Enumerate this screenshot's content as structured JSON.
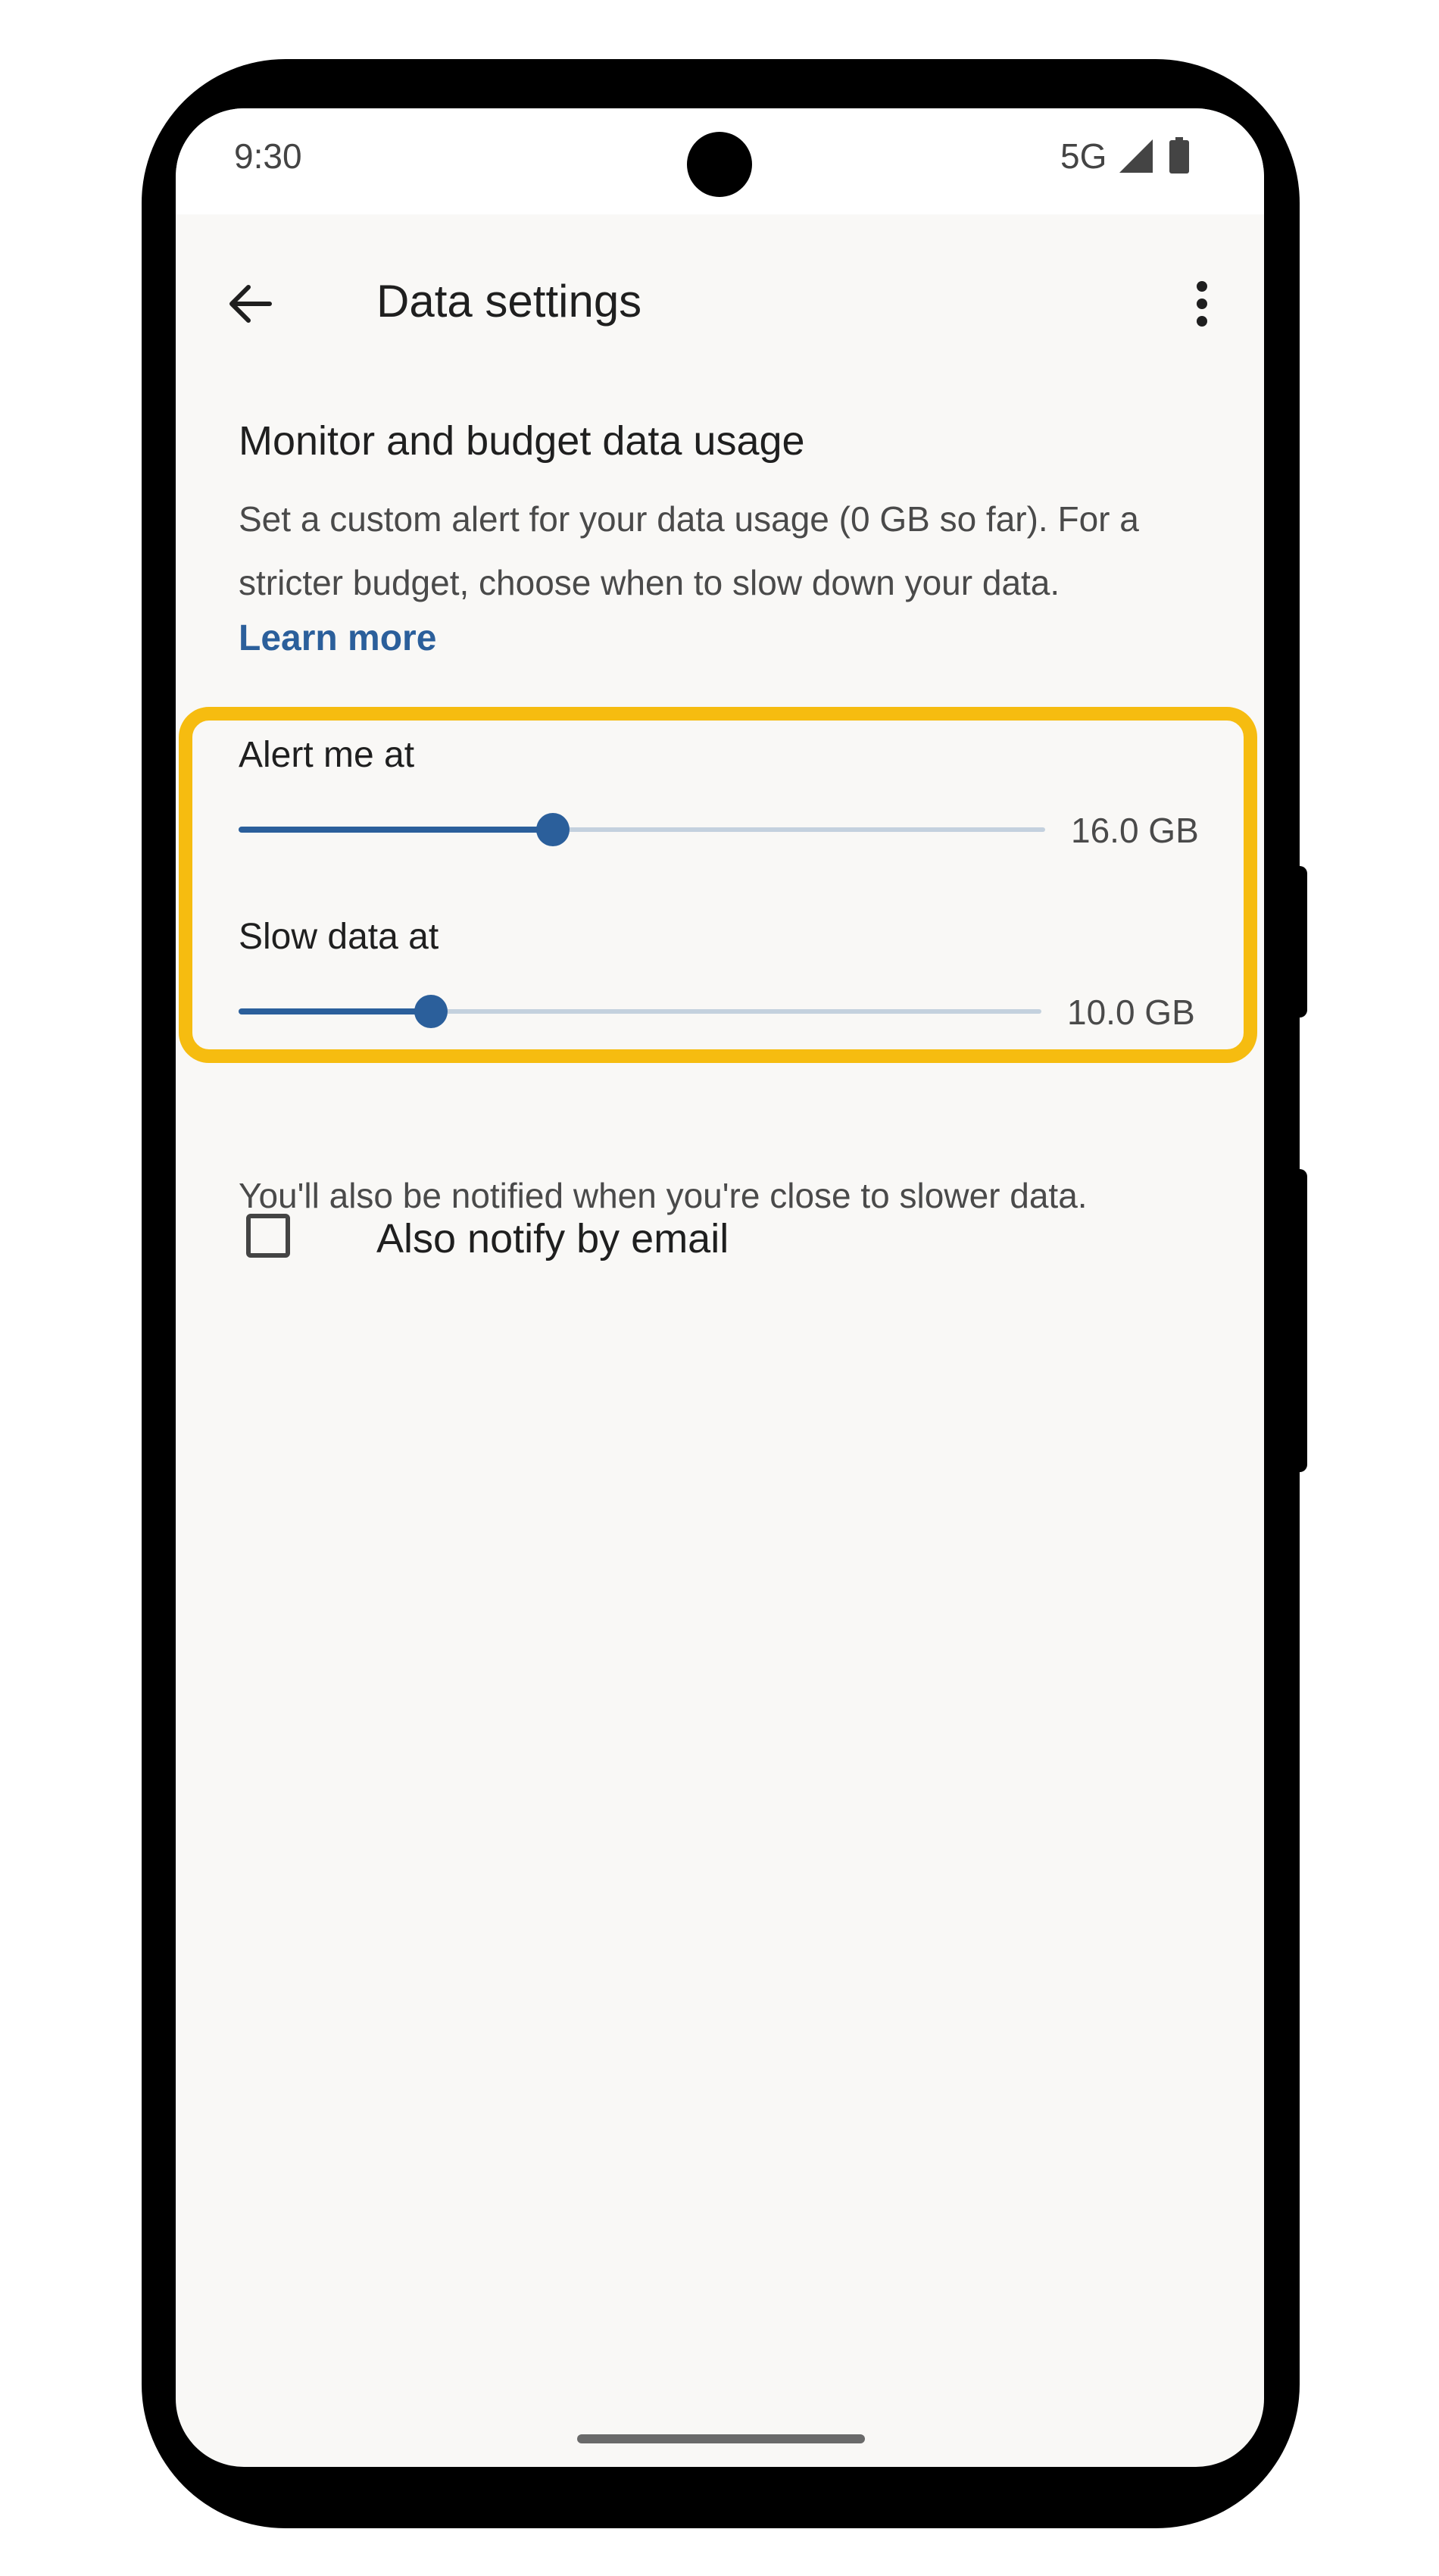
{
  "status_bar": {
    "time": "9:30",
    "network": "5G",
    "icons": [
      "signal-icon",
      "battery-icon"
    ]
  },
  "app_bar": {
    "title": "Data settings",
    "back_icon": "arrow-back-icon",
    "more_icon": "more-vert-icon"
  },
  "section": {
    "title": "Monitor and budget data usage",
    "description": "Set a custom alert for your data usage (0 GB so far). For a stricter budget, choose when to slow down your data.",
    "learn_more": "Learn more"
  },
  "sliders": [
    {
      "label": "Alert me at",
      "value_text": "16.0 GB",
      "fraction": 0.39
    },
    {
      "label": "Slow data at",
      "value_text": "10.0 GB",
      "fraction": 0.24
    }
  ],
  "note": "You'll also be notified when you're close to slower data.",
  "email_option": {
    "label": "Also notify by email",
    "checked": false
  },
  "colors": {
    "accent": "#2b5f9b",
    "highlight": "#f6bc10",
    "track": "#c4d1de",
    "background": "#f9f8f6"
  }
}
